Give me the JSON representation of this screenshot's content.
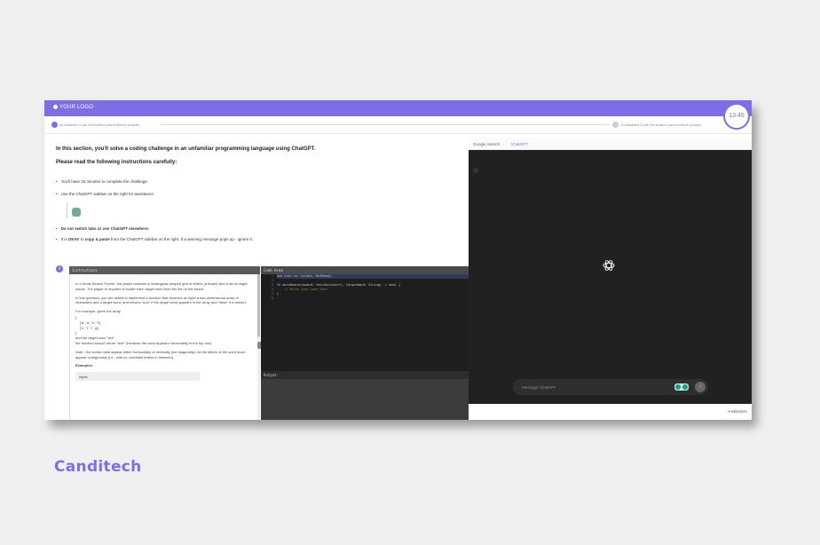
{
  "header": {
    "logo": "YOUR LOGO",
    "timer": "13:46"
  },
  "steps": [
    {
      "label": "AI-Assisted Code Generation (word search puzzle)"
    },
    {
      "label": "AI-Assisted Code Generation (word search puzzle)"
    }
  ],
  "intro": {
    "heading": "In this section, you'll solve a coding challenge in an unfamiliar programming language using ChatGPT.",
    "subheading": "Please read the following instructions carefully:",
    "bullet1": "You'll have 15 minutes to complete the challenge.",
    "bullet2": "Use the ChatGPT sidebar on the right for assistance:",
    "bullet3": "Do not switch tabs or use ChatGPT elsewhere.",
    "bullet4_pre": "It is ",
    "bullet4_okay": "OKAY",
    "bullet4_mid": " to ",
    "bullet4_copy": "copy & paste",
    "bullet4_post": " from the ChatGPT sidebar on the right. If a warning message pops up - ignore it."
  },
  "section_number": "1",
  "instructions": {
    "title": "Instructions",
    "p1": "In a Word-Search Puzzle, the player receives a rectangular-shaped grid of letters (a board) and a list of target words. The player is required to locate each target word from the list on the board.",
    "p2": "In this question, you are asked to implement a function that receives as input a two-dimensional array of characters and a target word, and returns \"true\" if the target word appears in the array and \"false\" if it doesn't.",
    "p3": "For example, given the array",
    "arr_open": "[",
    "arr_row1": "['a', 'a', 'n', 't'],",
    "arr_row2": "['c', 'f', 'l', 'g']",
    "arr_close": "]",
    "p4": "and the target word \"ant\",",
    "p5": "the function should return \"true\" (because the word appears horizontally in the top row).",
    "p6": "Note - the words must appear either horizontally or vertically (not diagonally). All the letters of the word must appear contiguously (i.e., with no unrelated letters in between).",
    "examples": "Examples:",
    "input": "Input:"
  },
  "code_area": {
    "title": "Code Area",
    "lines": [
      "1",
      "2",
      "3",
      "4",
      "5",
      "6"
    ],
    "code1": "use std::io::{stdin, BufRead};",
    "code3": "fn wordSearch(board: Vec<Vec<char>>, targetWord: String) -> bool {",
    "code4": "    // Write your code here.",
    "code5": "}"
  },
  "output": {
    "title": "Output:"
  },
  "chatgpt": {
    "tab1": "Google Search",
    "tab2": "ChatGPT",
    "placeholder": "Message ChatGPT",
    "send": "↑",
    "minimize": "⇥  Minimize"
  },
  "brand": "Canditech",
  "colors": {
    "accent": "#7b6ee6",
    "gpt_bg": "#212121",
    "gpt_green": "#10a37f"
  }
}
